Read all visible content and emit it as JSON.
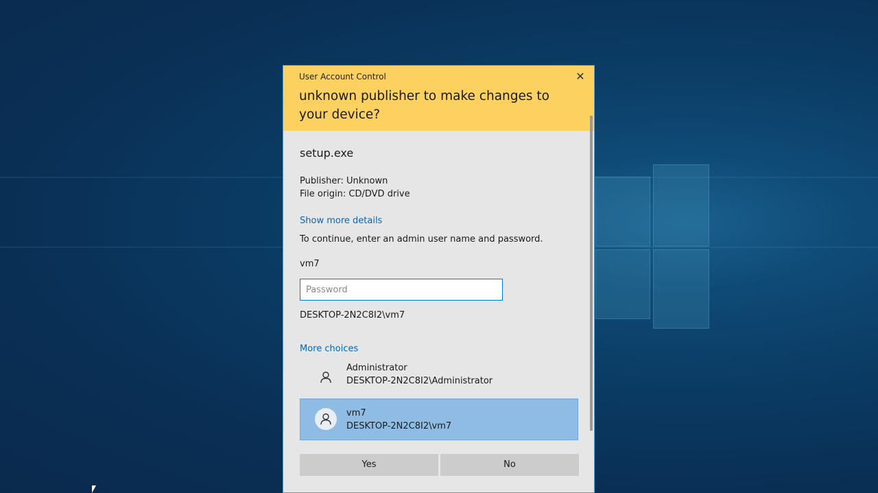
{
  "dialog": {
    "title": "User Account Control",
    "close_glyph": "✕",
    "question": "unknown publisher to make changes to your device?",
    "program_name": "setup.exe",
    "publisher": "Publisher: Unknown",
    "file_origin": "File origin: CD/DVD drive",
    "show_details_link": "Show more details",
    "instructions": "To continue, enter an admin user name and password.",
    "username": "vm7",
    "password_placeholder": "Password",
    "password_value": "",
    "domain_user": "DESKTOP-2N2C8I2\\vm7",
    "more_choices_link": "More choices",
    "accounts": [
      {
        "name": "Administrator",
        "domain": "DESKTOP-2N2C8I2\\Administrator",
        "selected": false
      },
      {
        "name": "vm7",
        "domain": "DESKTOP-2N2C8I2\\vm7",
        "selected": true
      }
    ],
    "yes_label": "Yes",
    "no_label": "No"
  },
  "colors": {
    "header": "#fdd15f",
    "body": "#e6e6e6",
    "link": "#0067c0",
    "selected_account": "#8fbce4",
    "button": "#cccccc",
    "desktop": "#0a3a62"
  },
  "icons": {
    "close": "close-icon",
    "account": "user-icon"
  }
}
